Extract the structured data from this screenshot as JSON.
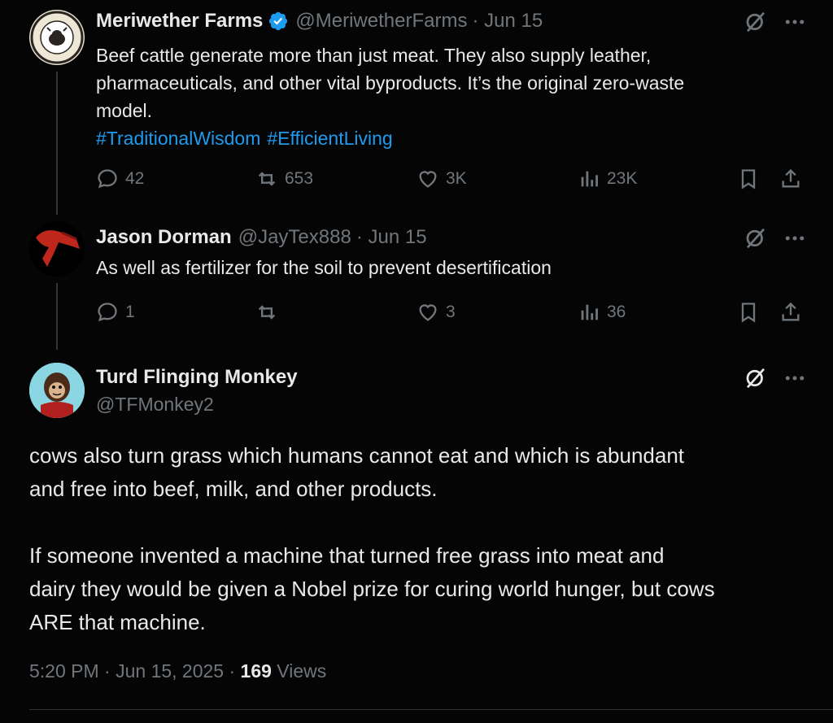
{
  "tweets": [
    {
      "name": "Meriwether Farms",
      "handle": "@MeriwetherFarms",
      "date": "· Jun 15",
      "avatar_text_top": "MERIWETHER",
      "avatar_text_bottom": "FARMS",
      "text_line1": "Beef cattle generate more than just meat. They also supply leather,",
      "text_line2": "pharmaceuticals, and other vital byproducts. It’s the original zero-waste",
      "text_line3": "model.",
      "hashtag1": "#TraditionalWisdom",
      "hashtag2": "#EfficientLiving",
      "replies": "42",
      "reposts": "653",
      "likes": "3K",
      "views": "23K"
    },
    {
      "name": "Jason Dorman",
      "handle": "@JayTex888",
      "date": "· Jun 15",
      "text": "As well as fertilizer for the soil to prevent desertification",
      "replies": "1",
      "reposts": "",
      "likes": "3",
      "views": "36"
    }
  ],
  "main_tweet": {
    "name": "Turd Flinging Monkey",
    "handle": "@TFMonkey2",
    "para1_line1": "cows also turn grass which humans cannot eat and which is abundant",
    "para1_line2": "and free into beef, milk, and other products.",
    "para2_line1": "If someone invented a machine that turned free grass into meat and",
    "para2_line2": "dairy they would be given a Nobel prize for curing world hunger, but cows",
    "para2_line3": "ARE that machine.",
    "timestamp": "5:20 PM · Jun 15, 2025 · ",
    "view_count": "169",
    "views_label": " Views"
  },
  "icons": {
    "verified_color": "#1d9bf0",
    "text_muted": "#71767b"
  }
}
